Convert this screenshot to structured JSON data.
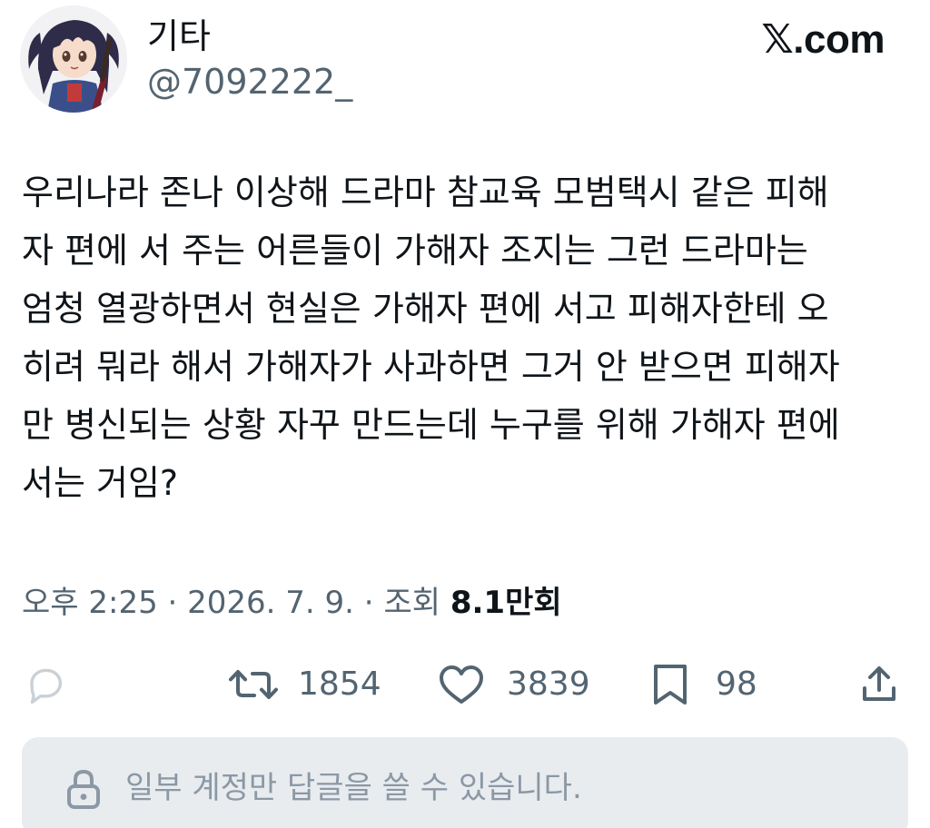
{
  "author": {
    "display_name": "기타",
    "handle": "@7092222_",
    "avatar": "anime-girl-guitar-figure"
  },
  "brand": {
    "x_mark": "𝕏",
    "domain": ".com"
  },
  "tweet": {
    "lines": [
      "우리나라 존나 이상해 드라마 참교육 모범택시 같은 피해",
      "자 편에 서 주는 어른들이 가해자 조지는 그런 드라마는",
      "엄청 열광하면서 현실은 가해자 편에 서고 피해자한테 오",
      "히려 뭐라 해서 가해자가 사과하면 그거 안 받으면 피해자",
      "만 병신되는 상황 자꾸 만드는데 누구를 위해 가해자 편에",
      "서는 거임?"
    ]
  },
  "meta": {
    "time": "오후 2:25",
    "separator": " · ",
    "date": "2026. 7. 9.",
    "views_label": "조회",
    "views_count": "8.1",
    "views_unit": "만회"
  },
  "actions": {
    "reply_icon": "comment-bubble-icon",
    "retweet_icon": "retweet-icon",
    "retweet_count": "1854",
    "like_icon": "heart-icon",
    "like_count": "3839",
    "bookmark_icon": "bookmark-icon",
    "bookmark_count": "98",
    "share_icon": "share-icon"
  },
  "reply_restriction": {
    "icon": "lock-icon",
    "text": "일부 계정만 답글을 쓸 수 있습니다."
  },
  "colors": {
    "primary_text": "#0f1419",
    "secondary_text": "#536471",
    "restriction_bg": "#e8ecef",
    "restriction_text": "#8b98a5"
  }
}
